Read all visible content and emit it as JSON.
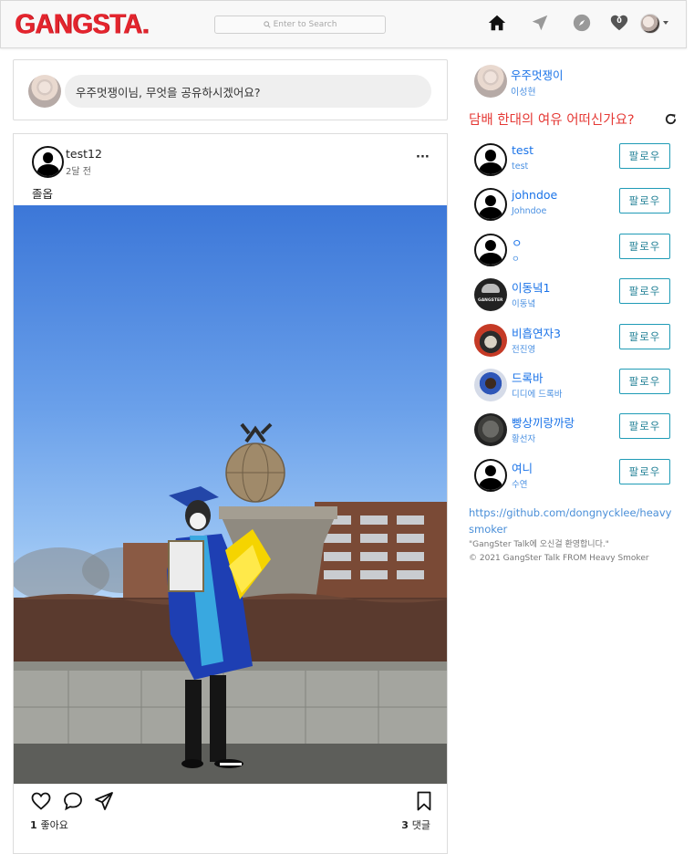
{
  "nav": {
    "logo": "GANGSTA.",
    "search_placeholder": "Enter to Search",
    "notification_count": "0"
  },
  "composer": {
    "prompt": "우주멋쟁이님, 무엇을 공유하시겠어요?"
  },
  "post": {
    "username": "test12",
    "time": "2달 전",
    "caption": "졸옵",
    "likes_count": "1",
    "likes_label": "좋아요",
    "comments_count": "3",
    "comments_label": "댓글"
  },
  "sidebar": {
    "me": {
      "name": "우주멋쟁이",
      "real_name": "이성현"
    },
    "slogan": "담배 한대의 여유 어떠신가요?",
    "follow_label": "팔로우",
    "suggestions": [
      {
        "name": "test",
        "real_name": "test",
        "avatar": "default"
      },
      {
        "name": "johndoe",
        "real_name": "Johndoe",
        "avatar": "default"
      },
      {
        "name": "ㅇ",
        "real_name": "ㅇ",
        "avatar": "default"
      },
      {
        "name": "이동녘1",
        "real_name": "이동녘",
        "avatar": "gangster"
      },
      {
        "name": "비흡연자3",
        "real_name": "전진영",
        "avatar": "red"
      },
      {
        "name": "드록바",
        "real_name": "디디에 드록바",
        "avatar": "soccer"
      },
      {
        "name": "빵상끼랑까랑",
        "real_name": "황선자",
        "avatar": "alien"
      },
      {
        "name": "여니",
        "real_name": "수연",
        "avatar": "default"
      }
    ],
    "footer_link": "https://github.com/dongnycklee/heavysmoker",
    "footer_welcome": "\"GangSter Talk에 오신걸 환영합니다.\"",
    "footer_copyright": "© 2021 GangSter Talk FROM Heavy Smoker"
  }
}
